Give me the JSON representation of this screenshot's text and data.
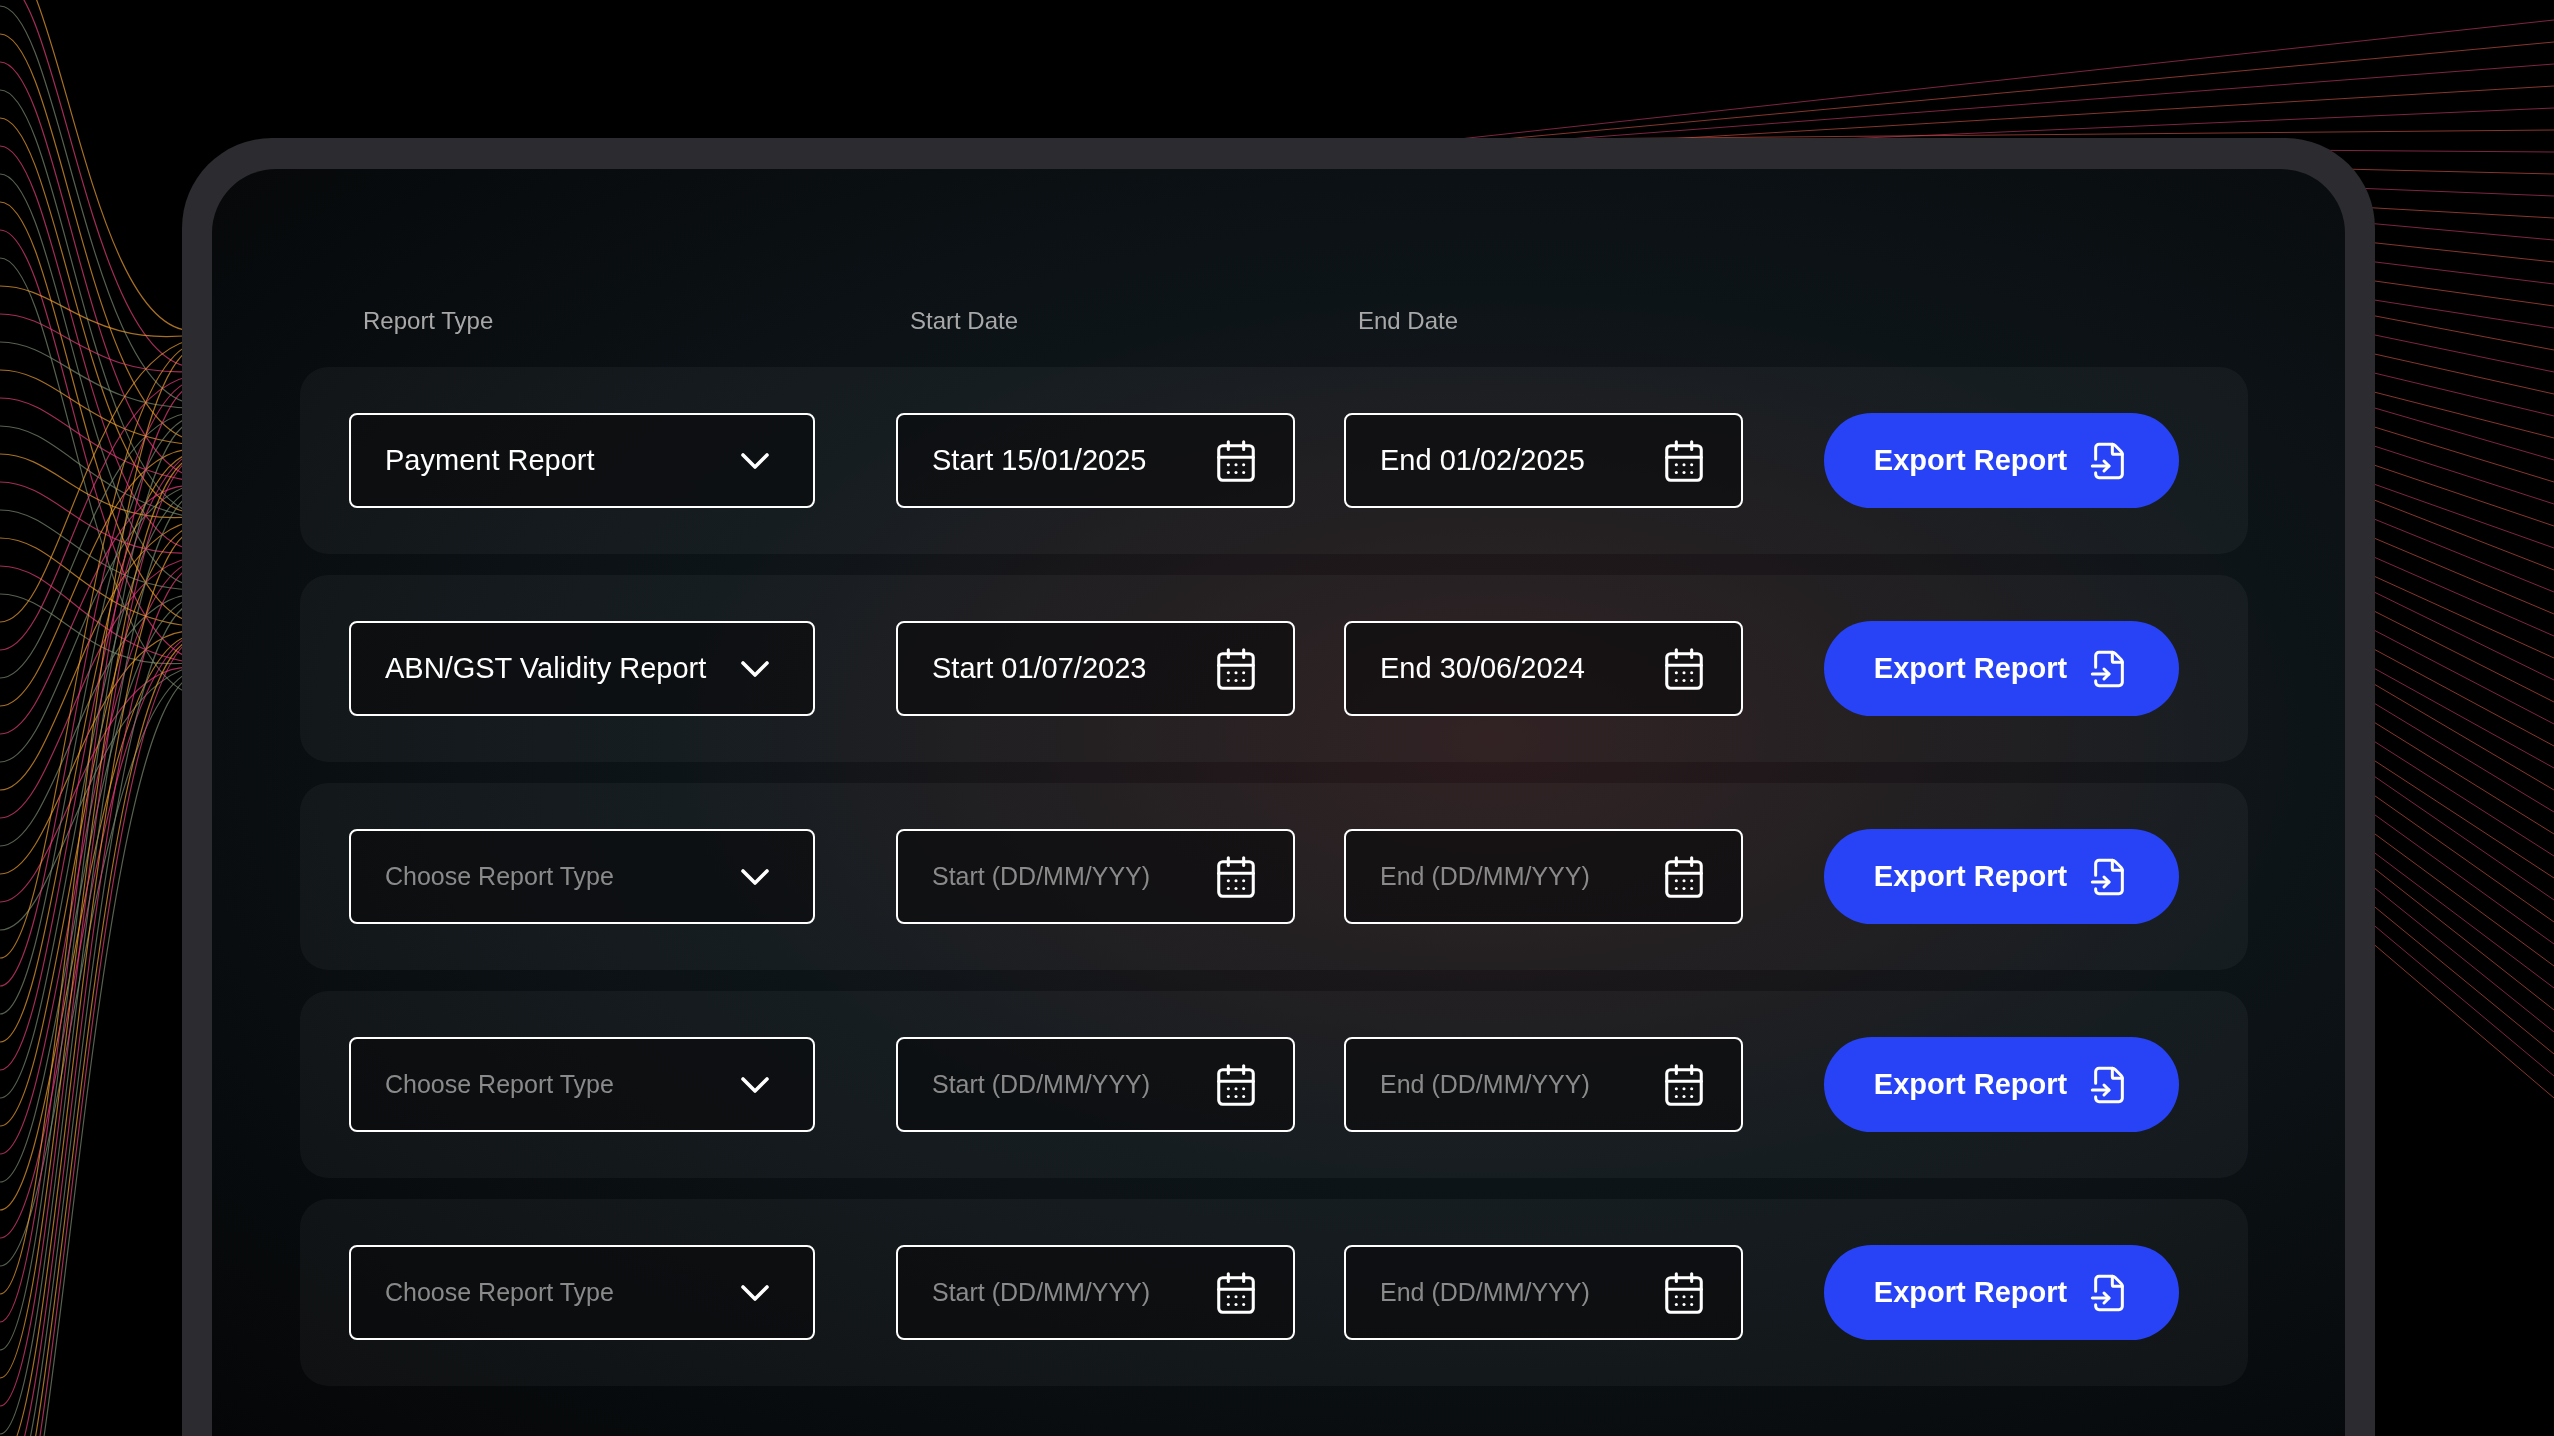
{
  "headers": [
    "Report Type",
    "Start Date",
    "End Date"
  ],
  "rows": [
    {
      "report_type": {
        "value": "Payment Report"
      },
      "start": {
        "value": "Start 15/01/2025"
      },
      "end": {
        "value": "End 01/02/2025"
      },
      "button": "Export Report"
    },
    {
      "report_type": {
        "value": "ABN/GST Validity Report"
      },
      "start": {
        "value": "Start 01/07/2023"
      },
      "end": {
        "value": "End 30/06/2024"
      },
      "button": "Export Report"
    },
    {
      "report_type": {
        "placeholder": "Choose Report Type"
      },
      "start": {
        "placeholder": "Start (DD/MM/YYY)"
      },
      "end": {
        "placeholder": "End (DD/MM/YYY)"
      },
      "button": "Export Report"
    },
    {
      "report_type": {
        "placeholder": "Choose Report Type"
      },
      "start": {
        "placeholder": "Start (DD/MM/YYY)"
      },
      "end": {
        "placeholder": "End (DD/MM/YYY)"
      },
      "button": "Export Report"
    },
    {
      "report_type": {
        "placeholder": "Choose Report Type"
      },
      "start": {
        "placeholder": "Start (DD/MM/YYY)"
      },
      "end": {
        "placeholder": "End (DD/MM/YYY)"
      },
      "button": "Export Report"
    }
  ]
}
